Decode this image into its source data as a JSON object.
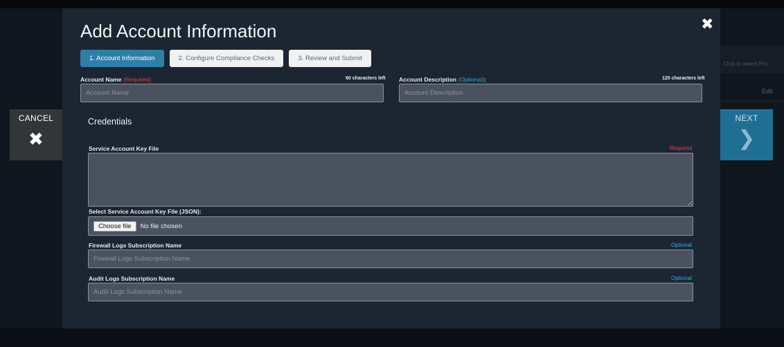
{
  "background": {
    "right_strip_text": "Click to select Pro",
    "edit_label": "Edit"
  },
  "nav": {
    "cancel_label": "CANCEL",
    "cancel_icon": "close-icon",
    "next_label": "NEXT",
    "next_icon": "chevron-right-icon"
  },
  "modal": {
    "title": "Add Account Information",
    "close_icon": "close-icon",
    "steps": [
      {
        "label": "1. Account Information",
        "active": true
      },
      {
        "label": "2. Configure Compliance Checks",
        "active": false
      },
      {
        "label": "3. Review and Submit",
        "active": false
      }
    ],
    "account_name": {
      "label": "Account Name",
      "tag": "(Required)",
      "counter": "60 characters left",
      "placeholder": "Account Name",
      "value": ""
    },
    "account_description": {
      "label": "Account Description",
      "tag": "(Optional)",
      "suffix": ":",
      "counter": "120 characters left",
      "placeholder": "Account Description",
      "value": ""
    },
    "credentials": {
      "title": "Credentials",
      "key_file": {
        "label": "Service Account Key File",
        "tag": "Required",
        "value": ""
      },
      "select_file": {
        "label": "Select Service Account Key File (JSON):",
        "button": "Choose file",
        "status": "No file chosen"
      },
      "firewall_logs": {
        "label": "Firewall Logs Subscription Name",
        "tag": "Optional",
        "placeholder": "Firewall Logs Subscription Name",
        "value": ""
      },
      "audit_logs": {
        "label": "Audit Logs Subscription Name",
        "tag": "Optional",
        "placeholder": "Audit Logs Subscription Name",
        "value": ""
      }
    }
  },
  "colors": {
    "accent": "#2e7fa8",
    "required": "#e0443f",
    "optional": "#39a9dd",
    "modal_bg": "#1c2633"
  }
}
